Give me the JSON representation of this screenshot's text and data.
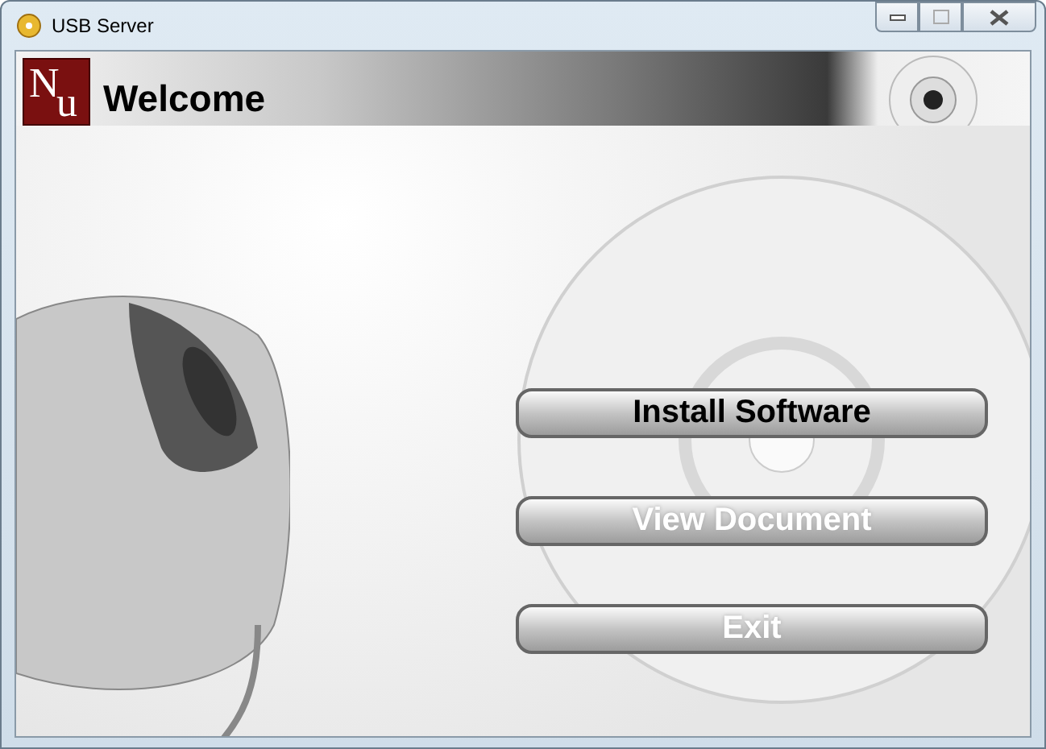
{
  "window": {
    "title": "USB Server"
  },
  "header": {
    "logo": [
      "N",
      "u"
    ],
    "title": "Welcome"
  },
  "buttons": [
    {
      "label": "Install Software",
      "selected": true
    },
    {
      "label": "View Document",
      "selected": false
    },
    {
      "label": "Exit",
      "selected": false
    }
  ]
}
